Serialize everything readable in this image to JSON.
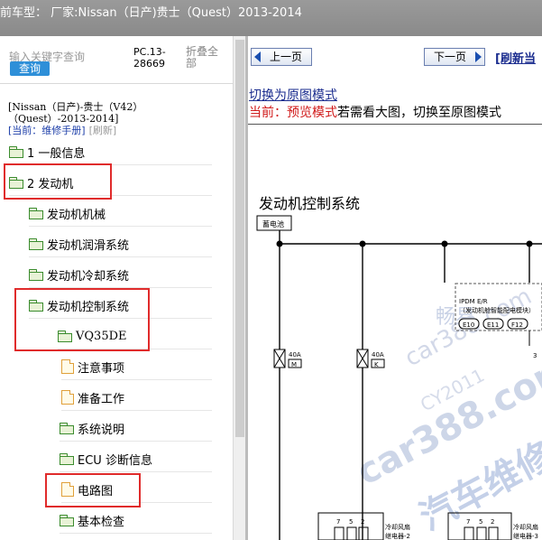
{
  "window": {
    "title": "前车型：  厂家:Nissan（日产)贵士（Quest）2013-2014"
  },
  "search": {
    "placeholder": "输入关键字查询",
    "button": "查询"
  },
  "doc_code": "PC.13-28669",
  "collapse_label": "折叠全部",
  "model_path": "[Nissan（日产)-贵士（V42）（Quest）-2013-2014]",
  "current": {
    "label": "[当前：维修手册]",
    "refresh": "[刷新]"
  },
  "tree": [
    {
      "label": "1 一般信息",
      "icon": "folder-icon"
    },
    {
      "label": "2 发动机",
      "icon": "folder-open-icon"
    },
    {
      "label": "发动机机械",
      "icon": "folder-icon"
    },
    {
      "label": "发动机润滑系统",
      "icon": "folder-icon"
    },
    {
      "label": "发动机冷却系统",
      "icon": "folder-icon"
    },
    {
      "label": "发动机控制系统",
      "icon": "folder-open-icon"
    },
    {
      "label": "VQ35DE",
      "icon": "folder-open-icon"
    },
    {
      "label": "注意事项",
      "icon": "document-icon"
    },
    {
      "label": "准备工作",
      "icon": "document-icon"
    },
    {
      "label": "系统说明",
      "icon": "folder-icon"
    },
    {
      "label": "ECU 诊断信息",
      "icon": "folder-icon"
    },
    {
      "label": "电路图",
      "icon": "document-icon"
    },
    {
      "label": "基本检查",
      "icon": "folder-icon"
    }
  ],
  "nav": {
    "prev": "上一页",
    "next": "下一页",
    "refresh": "[刷新当"
  },
  "mode_link": "切换为原图模式",
  "preview_notice": {
    "prefix": "当前：预览模式",
    "rest": "若需看大图，切换至原图模式"
  },
  "diagram": {
    "title": "发动机控制系统",
    "battery": "蓄电池",
    "fuse1_amp": "40A",
    "fuse1_id": "M",
    "fuse2_amp": "40A",
    "fuse2_id": "K",
    "pdm_line1": "IPDM E/R",
    "pdm_line2": "（发动机舱智能配电模块）",
    "connectors": [
      "E10",
      "E11",
      "F12"
    ],
    "relay1_pins": [
      "7",
      "5",
      "2"
    ],
    "relay1_label": [
      "冷却风扇",
      "继电器-2"
    ],
    "relay2_pins": [
      "7",
      "5",
      "2"
    ],
    "relay2_label": [
      "冷却风扇",
      "继电器-3"
    ],
    "pin_right": "3",
    "watermarks": [
      "畅易",
      "car388.com",
      "CY2011",
      "car388.com",
      "汽车维修"
    ]
  },
  "colors": {
    "highlight": "#e02b2b",
    "link": "#1b2d8f",
    "accent": "#2e8fd8"
  }
}
